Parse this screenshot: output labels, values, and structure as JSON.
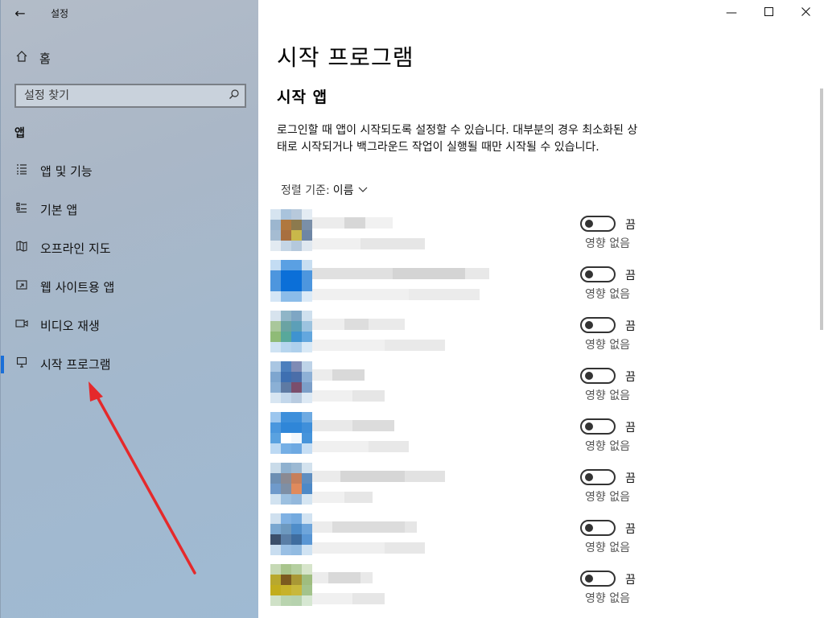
{
  "window": {
    "app_title": "설정",
    "back_icon": "back-arrow-icon",
    "controls": [
      "minimize-icon",
      "maximize-icon",
      "close-icon"
    ]
  },
  "sidebar": {
    "home_label": "홈",
    "search_placeholder": "설정 찾기",
    "section_heading": "앱",
    "items": [
      {
        "label": "앱 및 기능",
        "icon": "list-icon",
        "active": false
      },
      {
        "label": "기본 앱",
        "icon": "default-apps-icon",
        "active": false
      },
      {
        "label": "오프라인 지도",
        "icon": "map-icon",
        "active": false
      },
      {
        "label": "웹 사이트용 앱",
        "icon": "web-apps-icon",
        "active": false
      },
      {
        "label": "비디오 재생",
        "icon": "video-icon",
        "active": false
      },
      {
        "label": "시작 프로그램",
        "icon": "startup-icon",
        "active": true
      }
    ]
  },
  "main": {
    "page_title": "시작 프로그램",
    "sub_title": "시작 앱",
    "description": "로그인할 때 앱이 시작되도록 설정할 수 있습니다. 대부분의 경우 최소화된 상태로 시작되거나 백그라운드 작업이 실행될 때만 시작될 수 있습니다.",
    "sort_label": "정렬 기준:",
    "sort_value": "이름",
    "apps": [
      {
        "toggle_label": "끔",
        "impact": "영향 없음",
        "on": false
      },
      {
        "toggle_label": "끔",
        "impact": "영향 없음",
        "on": false
      },
      {
        "toggle_label": "끔",
        "impact": "영향 없음",
        "on": false
      },
      {
        "toggle_label": "끔",
        "impact": "영향 없음",
        "on": false
      },
      {
        "toggle_label": "끔",
        "impact": "영향 없음",
        "on": false
      },
      {
        "toggle_label": "끔",
        "impact": "영향 없음",
        "on": false
      },
      {
        "toggle_label": "끔",
        "impact": "영향 없음",
        "on": false
      },
      {
        "toggle_label": "끔",
        "impact": "영향 없음",
        "on": false
      }
    ]
  },
  "colors": {
    "accent": "#1a6fd8",
    "annotation_arrow": "#e5292b"
  }
}
